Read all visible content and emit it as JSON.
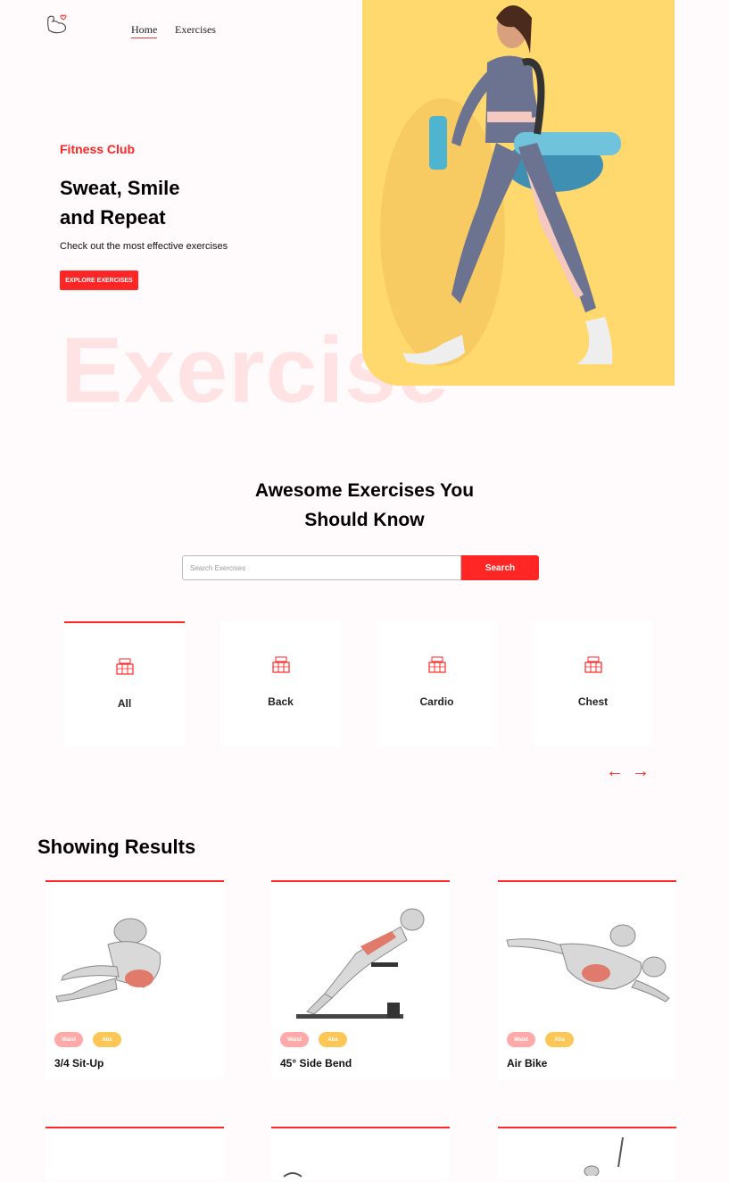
{
  "nav": {
    "home": "Home",
    "exercises": "Exercises"
  },
  "hero": {
    "eyebrow": "Fitness Club",
    "title_line1": "Sweat, Smile",
    "title_line2": "and Repeat",
    "subtitle": "Check out the most effective exercises",
    "button": "EXPLORE EXERCISES",
    "watermark": "Exercise"
  },
  "search": {
    "title_line1": "Awesome Exercises You",
    "title_line2": "Should Know",
    "placeholder": "Search Exercises",
    "button": "Search"
  },
  "categories": [
    {
      "label": "All",
      "icon": "gym-icon"
    },
    {
      "label": "Back",
      "icon": "gym-icon"
    },
    {
      "label": "Cardio",
      "icon": "gym-icon"
    },
    {
      "label": "Chest",
      "icon": "gym-icon"
    }
  ],
  "arrows": {
    "prev": "←",
    "next": "→"
  },
  "results": {
    "title": "Showing Results",
    "items": [
      {
        "name": "3/4 Sit-Up",
        "tag1": "Waist",
        "tag2": "Abs"
      },
      {
        "name": "45° Side Bend",
        "tag1": "Waist",
        "tag2": "Abs"
      },
      {
        "name": "Air Bike",
        "tag1": "Waist",
        "tag2": "Abs"
      }
    ]
  },
  "colors": {
    "accent": "#ff2625",
    "tag_pink": "#ffa9a9",
    "tag_yellow": "#fcc757",
    "hero_bg": "#ffd86e"
  }
}
